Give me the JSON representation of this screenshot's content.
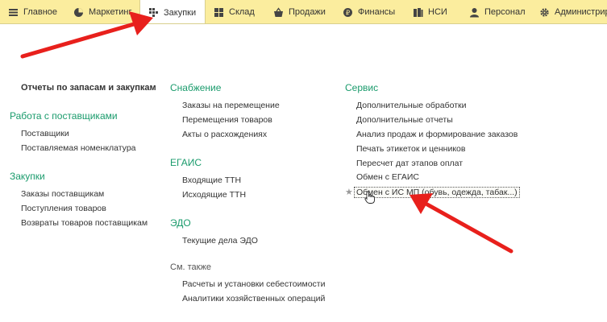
{
  "tabs": [
    {
      "label": "Главное",
      "icon": "menu-icon"
    },
    {
      "label": "Маркетинг",
      "icon": "pie-chart-icon"
    },
    {
      "label": "Закупки",
      "icon": "cart-icon",
      "active": true
    },
    {
      "label": "Склад",
      "icon": "grid-icon"
    },
    {
      "label": "Продажи",
      "icon": "basket-icon"
    },
    {
      "label": "Финансы",
      "icon": "coin-icon"
    },
    {
      "label": "НСИ",
      "icon": "books-icon"
    },
    {
      "label": "Персонал",
      "icon": "person-icon"
    },
    {
      "label": "Администрир",
      "icon": "gear-icon"
    }
  ],
  "col1": {
    "reports": "Отчеты по запасам и закупкам",
    "suppliers_heading": "Работа с поставщиками",
    "suppliers_items": [
      "Поставщики",
      "Поставляемая номенклатура"
    ],
    "purchases_heading": "Закупки",
    "purchases_items": [
      "Заказы поставщикам",
      "Поступления товаров",
      "Возвраты товаров поставщикам"
    ]
  },
  "col2": {
    "supply_heading": "Снабжение",
    "supply_items": [
      "Заказы на перемещение",
      "Перемещения товаров",
      "Акты о расхождениях"
    ],
    "egais_heading": "ЕГАИС",
    "egais_items": [
      "Входящие ТТН",
      "Исходящие ТТН"
    ],
    "edo_heading": "ЭДО",
    "edo_items": [
      "Текущие дела ЭДО"
    ],
    "see_also_heading": "См. также",
    "see_also_items": [
      "Расчеты и установки себестоимости",
      "Аналитики хозяйственных операций"
    ]
  },
  "col3": {
    "service_heading": "Сервис",
    "service_items": [
      "Дополнительные обработки",
      "Дополнительные отчеты",
      "Анализ продаж и формирование заказов",
      "Печать этикеток и ценников",
      "Пересчет дат этапов оплат",
      "Обмен с ЕГАИС",
      "Обмен с ИС МП (обувь, одежда, табак...)"
    ]
  },
  "colors": {
    "topbar": "#fbed9e",
    "heading_green": "#1a9b6c",
    "arrow_red": "#e8201c"
  }
}
